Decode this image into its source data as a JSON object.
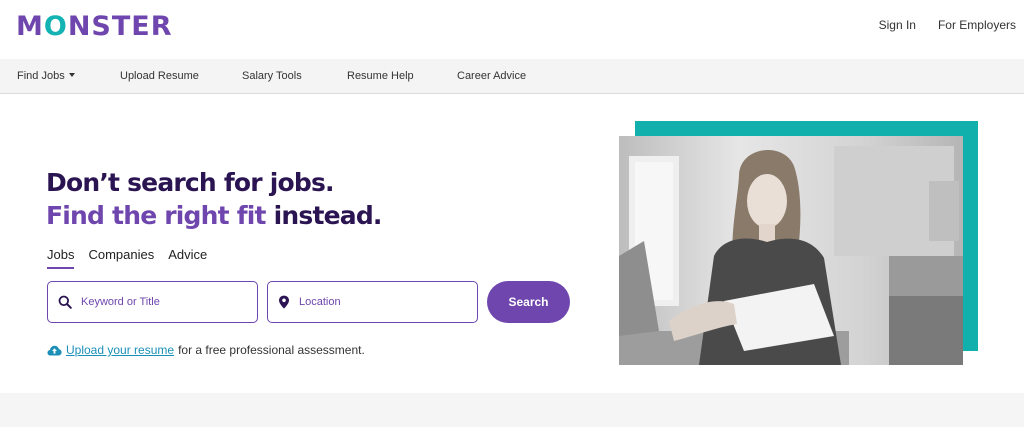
{
  "header": {
    "logo_text": "MONSTER",
    "sign_in": "Sign In",
    "for_employers": "For Employers"
  },
  "nav": {
    "items": [
      {
        "label": "Find Jobs",
        "has_dropdown": true
      },
      {
        "label": "Upload Resume"
      },
      {
        "label": "Salary Tools"
      },
      {
        "label": "Resume Help"
      },
      {
        "label": "Career Advice"
      }
    ]
  },
  "hero": {
    "headline_line1": "Don’t search for jobs.",
    "headline_line2_accent": "Find the right fit",
    "headline_line2_rest": " instead."
  },
  "search_tabs": [
    {
      "label": "Jobs",
      "active": true
    },
    {
      "label": "Companies",
      "active": false
    },
    {
      "label": "Advice",
      "active": false
    }
  ],
  "search": {
    "keyword_placeholder": "Keyword or Title",
    "location_placeholder": "Location",
    "button_label": "Search"
  },
  "upload": {
    "link_text": "Upload your resume",
    "rest_text": "for a free professional assessment."
  },
  "icons": {
    "search": "search-icon",
    "location": "map-pin-icon",
    "upload": "cloud-upload-icon",
    "dropdown": "caret-down-icon"
  },
  "colors": {
    "brand_purple": "#6e46ae",
    "headline_dark": "#2b1452",
    "accent_teal": "#11b0ac",
    "link_blue": "#1b8fb8"
  }
}
